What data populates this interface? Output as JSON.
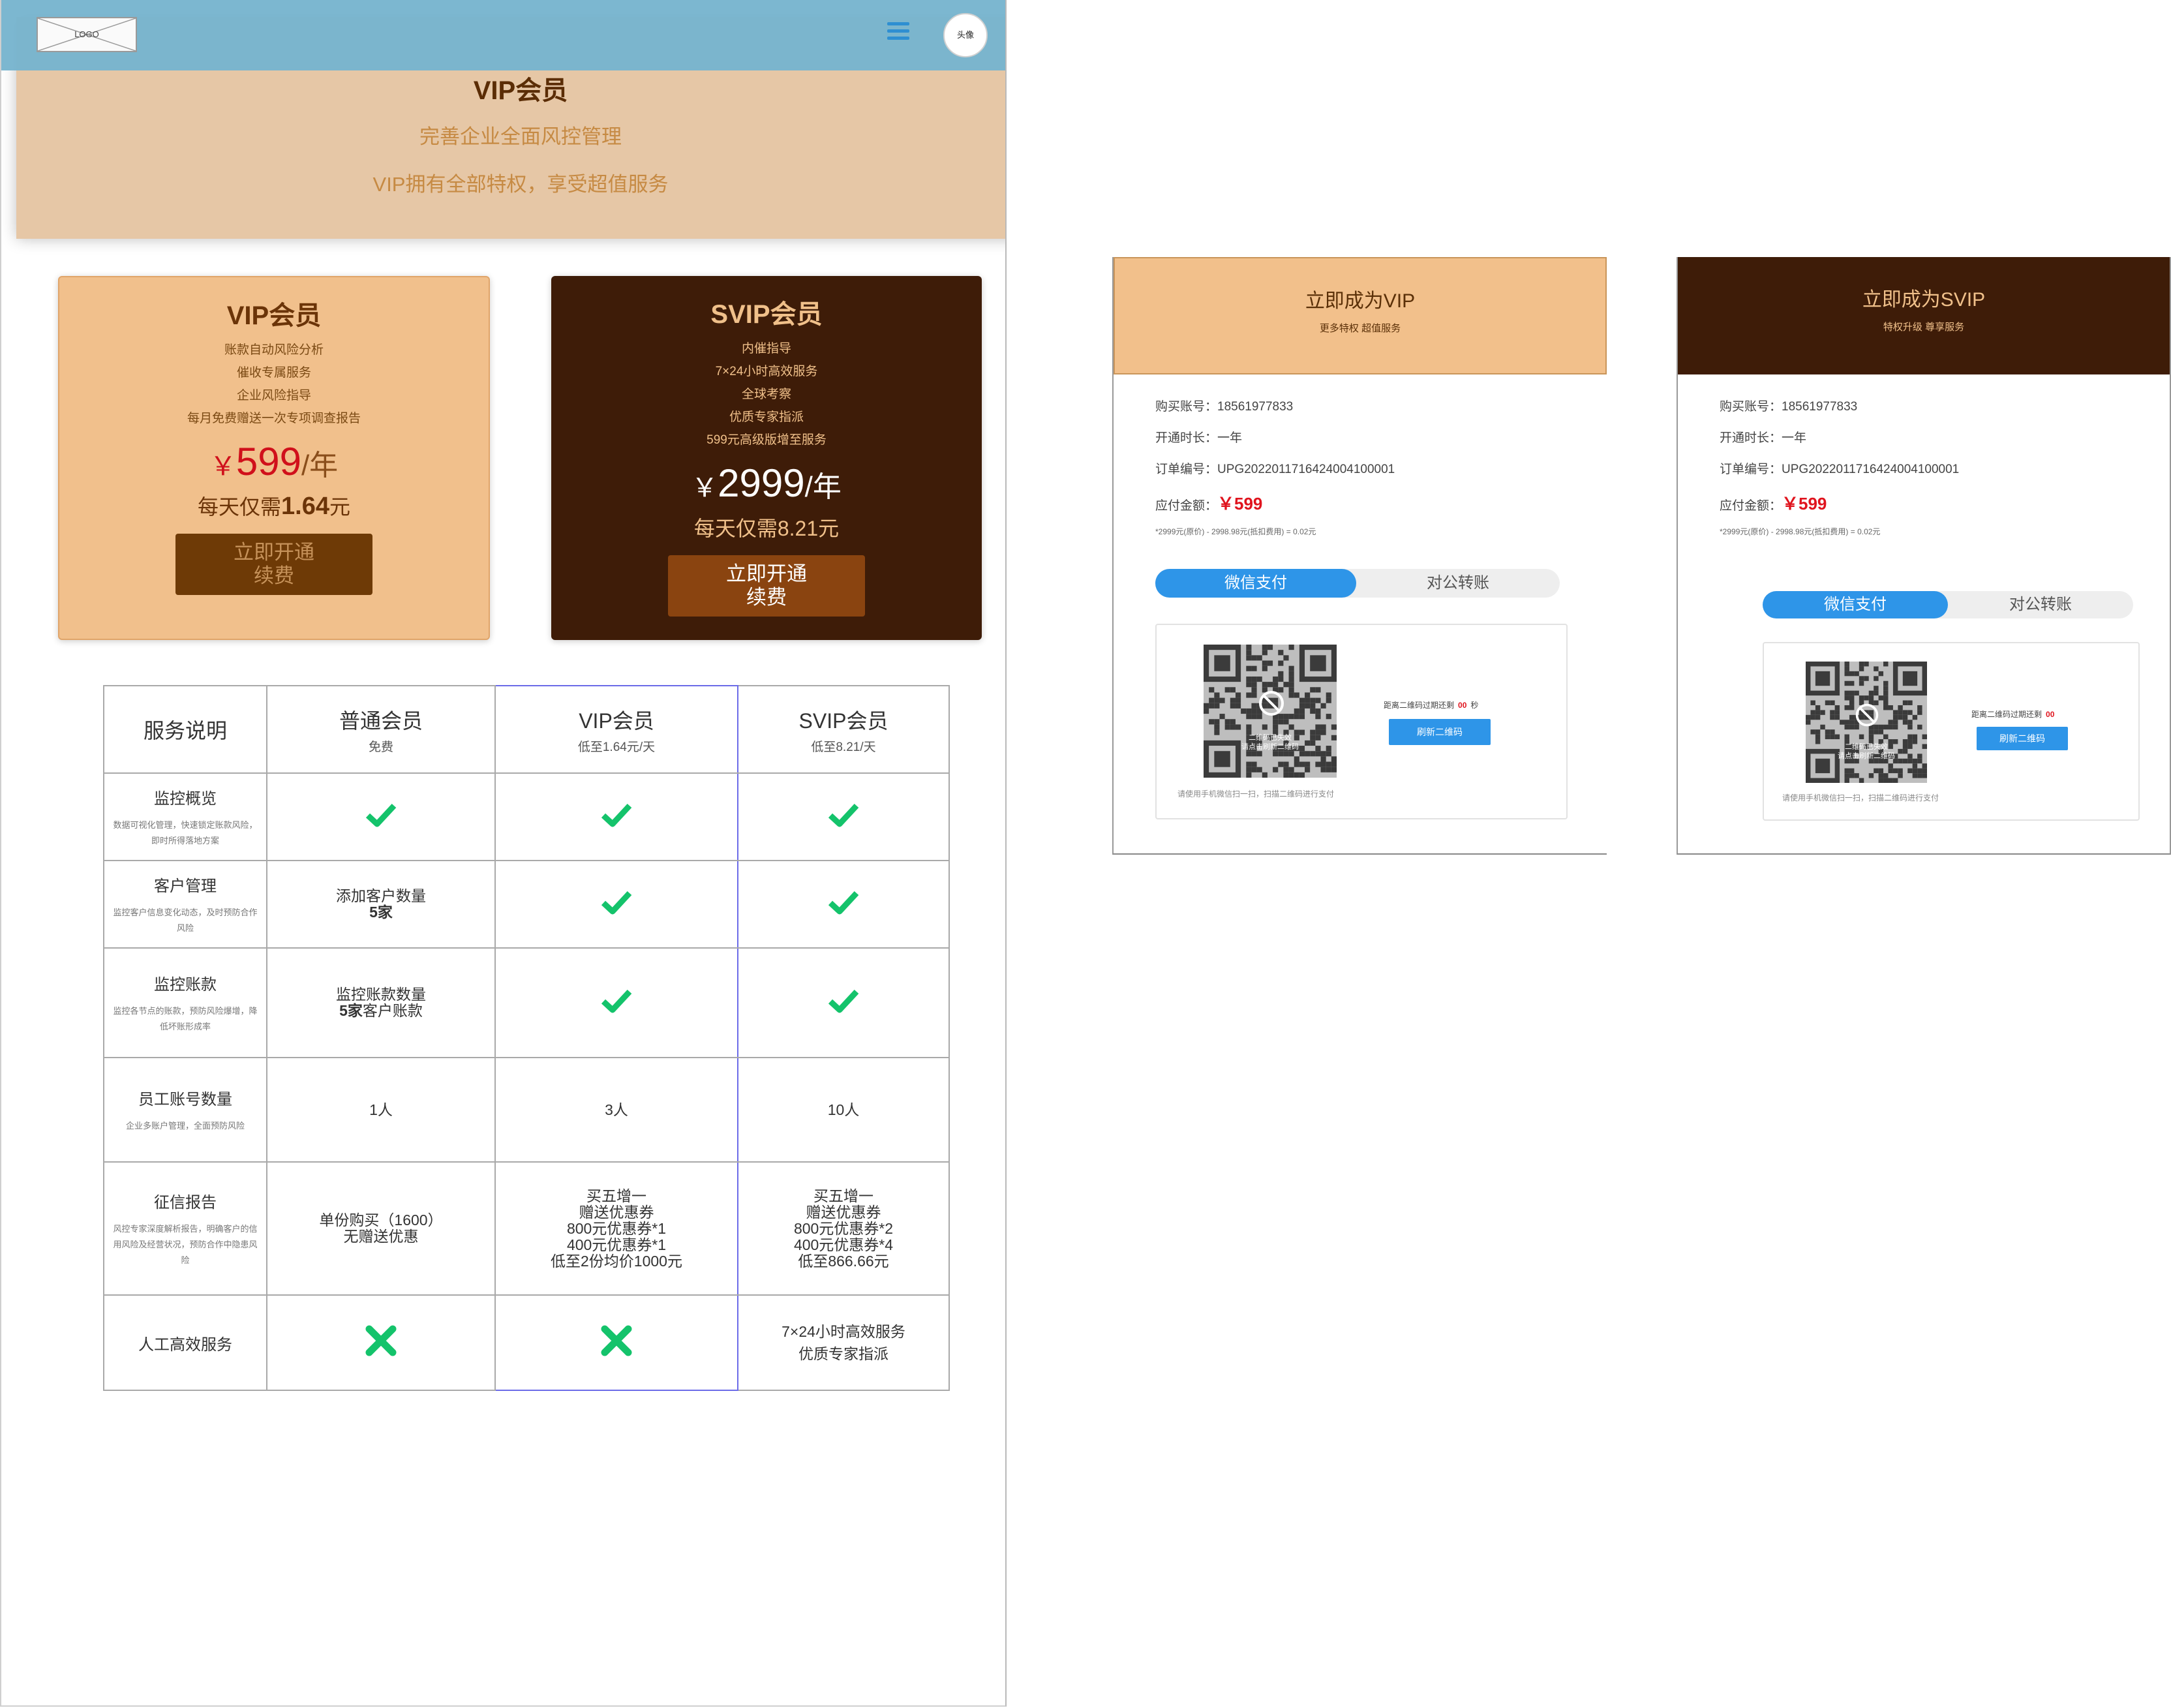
{
  "topbar": {
    "logo": "LOGO",
    "avatar": "头像"
  },
  "hero": {
    "title": "VIP会员",
    "subtitle": "完善企业全面风控管理",
    "tagline": "VIP拥有全部特权，享受超值服务"
  },
  "plans": {
    "vip": {
      "name": "VIP会员",
      "features": [
        "账款自动风险分析",
        "催收专属服务",
        "企业风险指导",
        "每月免费赠送一次专项调查报告"
      ],
      "currency": "￥",
      "price": "599",
      "unit": "/年",
      "daily_prefix": "每天仅需",
      "daily_value": "1.64",
      "daily_suffix": "元",
      "button_line1": "立即开通",
      "button_line2": "续费"
    },
    "svip": {
      "name": "SVIP会员",
      "features": [
        "内催指导",
        "7×24小时高效服务",
        "全球考察",
        "优质专家指派",
        "599元高级版增至服务"
      ],
      "currency": "￥",
      "price": "2999",
      "unit": "/年",
      "daily_prefix": "每天仅需",
      "daily_value": "8.21",
      "daily_suffix": "元",
      "button_line1": "立即开通",
      "button_line2": "续费"
    }
  },
  "table": {
    "header": {
      "service": "服务说明",
      "normal": "普通会员",
      "normal_sub": "免费",
      "vip": "VIP会员",
      "vip_sub": "低至1.64元/天",
      "svip": "SVIP会员",
      "svip_sub": "低至8.21/天"
    },
    "rows": {
      "monitor": {
        "title": "监控概览",
        "desc": "数据可视化管理，快速锁定账款风险，即时所得落地方案"
      },
      "customer": {
        "title": "客户管理",
        "desc": "监控客户信息变化动态，及时预防合作风险",
        "normal_l1": "添加客户数量",
        "normal_l2": "5家"
      },
      "account": {
        "title": "监控账款",
        "desc": "监控各节点的账款，预防风险爆增，降低坏账形成率",
        "normal_l1": "监控账款数量",
        "normal_l2a": "5家",
        "normal_l2b": "客户账款"
      },
      "staff": {
        "title": "员工账号数量",
        "desc": "企业多账户管理，全面预防风险",
        "normal": "1人",
        "vip": "3人",
        "svip": "10人"
      },
      "credit": {
        "title": "征信报告",
        "desc": "风控专家深度解析报告，明确客户的信用风险及经营状况，预防合作中隐患风险",
        "normal_l1": "单份购买（1600）",
        "normal_l2": "无赠送优惠",
        "vip": [
          "买五增一",
          "赠送优惠券",
          "800元优惠券*1",
          "400元优惠券*1",
          "低至2份均价1000元"
        ],
        "svip": [
          "买五增一",
          "赠送优惠券",
          "800元优惠券*2",
          "400元优惠券*4",
          "低至866.66元"
        ]
      },
      "manual": {
        "title": "人工高效服务",
        "svip_l1": "7×24小时高效服务",
        "svip_l2": "优质专家指派"
      }
    }
  },
  "pay": {
    "vip": {
      "title": "立即成为VIP",
      "subtitle": "更多特权 超值服务",
      "account_label": "购买账号：",
      "account": "18561977833",
      "duration_label": "开通时长：",
      "duration": "一年",
      "order_label": "订单编号：",
      "order": "UPG2022011716424004100001",
      "amount_label": "应付金额：",
      "amount": "￥599",
      "note": "*2999元(原价) - 2998.98元(抵扣费用) = 0.02元",
      "tab_wechat": "微信支付",
      "tab_transfer": "对公转账",
      "qr_l1": "二维码已失效",
      "qr_l2": "请点击刷新二维码",
      "countdown_label": "距离二维码过期还剩",
      "countdown": "00",
      "countdown_unit": "秒",
      "refresh": "刷新二维码",
      "hint": "请使用手机微信扫一扫，扫描二维码进行支付"
    },
    "svip": {
      "title": "立即成为SVIP",
      "subtitle": "特权升级 尊享服务",
      "account_label": "购买账号：",
      "account": "18561977833",
      "duration_label": "开通时长：",
      "duration": "一年",
      "order_label": "订单编号：",
      "order": "UPG2022011716424004100001",
      "amount_label": "应付金额：",
      "amount": "￥599",
      "note": "*2999元(原价) - 2998.98元(抵扣费用) = 0.02元",
      "tab_wechat": "微信支付",
      "tab_transfer": "对公转账",
      "qr_l1": "二维码已失效",
      "qr_l2": "请点击刷新二维码",
      "countdown_label": "距离二维码过期还剩",
      "countdown": "00",
      "countdown_unit": "秒",
      "refresh": "刷新二维码",
      "hint": "请使用手机微信扫一扫，扫描二维码进行支付"
    }
  },
  "colors": {
    "accent_blue": "#2e95e8",
    "vip_gold": "#f1c08c",
    "svip_brown": "#3e1c08",
    "check_green": "#14c36b",
    "price_red": "#e0141e"
  }
}
